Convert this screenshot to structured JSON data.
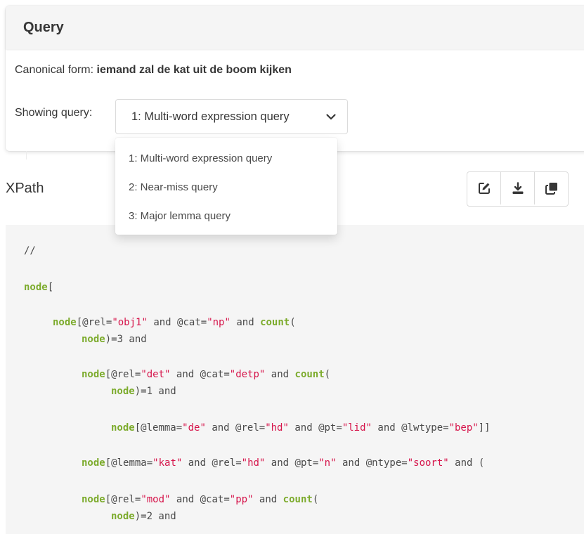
{
  "query_card": {
    "title": "Query",
    "canonical_label": "Canonical form: ",
    "canonical_value": "iemand zal de kat uit de boom kijken",
    "showing_label": "Showing query:",
    "selected_query": "1: Multi-word expression query"
  },
  "dropdown": {
    "options": [
      "1: Multi-word expression query",
      "2: Near-miss query",
      "3: Major lemma query"
    ]
  },
  "xpath": {
    "title": "XPath",
    "toolbar": [
      "edit-icon",
      "download-icon",
      "copy-icon"
    ]
  },
  "code_lines": [
    [
      [
        "t",
        "//"
      ]
    ],
    [
      [
        "k",
        "node"
      ],
      [
        "t",
        "["
      ]
    ],
    [
      [
        "k",
        "node"
      ],
      [
        "t",
        "["
      ],
      [
        "a",
        "@rel"
      ],
      [
        "t",
        "="
      ],
      [
        "s",
        "\"obj1\""
      ],
      [
        "t",
        " and "
      ],
      [
        "a",
        "@cat"
      ],
      [
        "t",
        "="
      ],
      [
        "s",
        "\"np\""
      ],
      [
        "t",
        " and "
      ],
      [
        "k",
        "count"
      ],
      [
        "t",
        "("
      ]
    ],
    [
      [
        "k",
        "node"
      ],
      [
        "t",
        ")=3 and"
      ]
    ],
    [
      [
        "k",
        "node"
      ],
      [
        "t",
        "["
      ],
      [
        "a",
        "@rel"
      ],
      [
        "t",
        "="
      ],
      [
        "s",
        "\"det\""
      ],
      [
        "t",
        " and "
      ],
      [
        "a",
        "@cat"
      ],
      [
        "t",
        "="
      ],
      [
        "s",
        "\"detp\""
      ],
      [
        "t",
        " and "
      ],
      [
        "k",
        "count"
      ],
      [
        "t",
        "("
      ]
    ],
    [
      [
        "k",
        "node"
      ],
      [
        "t",
        ")=1 and"
      ]
    ],
    [
      [
        "k",
        "node"
      ],
      [
        "t",
        "["
      ],
      [
        "a",
        "@lemma"
      ],
      [
        "t",
        "="
      ],
      [
        "s",
        "\"de\""
      ],
      [
        "t",
        " and "
      ],
      [
        "a",
        "@rel"
      ],
      [
        "t",
        "="
      ],
      [
        "s",
        "\"hd\""
      ],
      [
        "t",
        " and "
      ],
      [
        "a",
        "@pt"
      ],
      [
        "t",
        "="
      ],
      [
        "s",
        "\"lid\""
      ],
      [
        "t",
        " and "
      ],
      [
        "a",
        "@lwtype"
      ],
      [
        "t",
        "="
      ],
      [
        "s",
        "\"bep\""
      ],
      [
        "t",
        "]]"
      ]
    ],
    [
      [
        "k",
        "node"
      ],
      [
        "t",
        "["
      ],
      [
        "a",
        "@lemma"
      ],
      [
        "t",
        "="
      ],
      [
        "s",
        "\"kat\""
      ],
      [
        "t",
        " and "
      ],
      [
        "a",
        "@rel"
      ],
      [
        "t",
        "="
      ],
      [
        "s",
        "\"hd\""
      ],
      [
        "t",
        " and "
      ],
      [
        "a",
        "@pt"
      ],
      [
        "t",
        "="
      ],
      [
        "s",
        "\"n\""
      ],
      [
        "t",
        " and "
      ],
      [
        "a",
        "@ntype"
      ],
      [
        "t",
        "="
      ],
      [
        "s",
        "\"soort\""
      ],
      [
        "t",
        " and ("
      ]
    ],
    [
      [
        "k",
        "node"
      ],
      [
        "t",
        "["
      ],
      [
        "a",
        "@rel"
      ],
      [
        "t",
        "="
      ],
      [
        "s",
        "\"mod\""
      ],
      [
        "t",
        " and "
      ],
      [
        "a",
        "@cat"
      ],
      [
        "t",
        "="
      ],
      [
        "s",
        "\"pp\""
      ],
      [
        "t",
        " and "
      ],
      [
        "k",
        "count"
      ],
      [
        "t",
        "("
      ]
    ],
    [
      [
        "k",
        "node"
      ],
      [
        "t",
        ")=2 and"
      ]
    ]
  ],
  "colors": {
    "keyword": "#7cab2c",
    "string": "#d6154b",
    "code_bg": "#f5f5f5"
  }
}
